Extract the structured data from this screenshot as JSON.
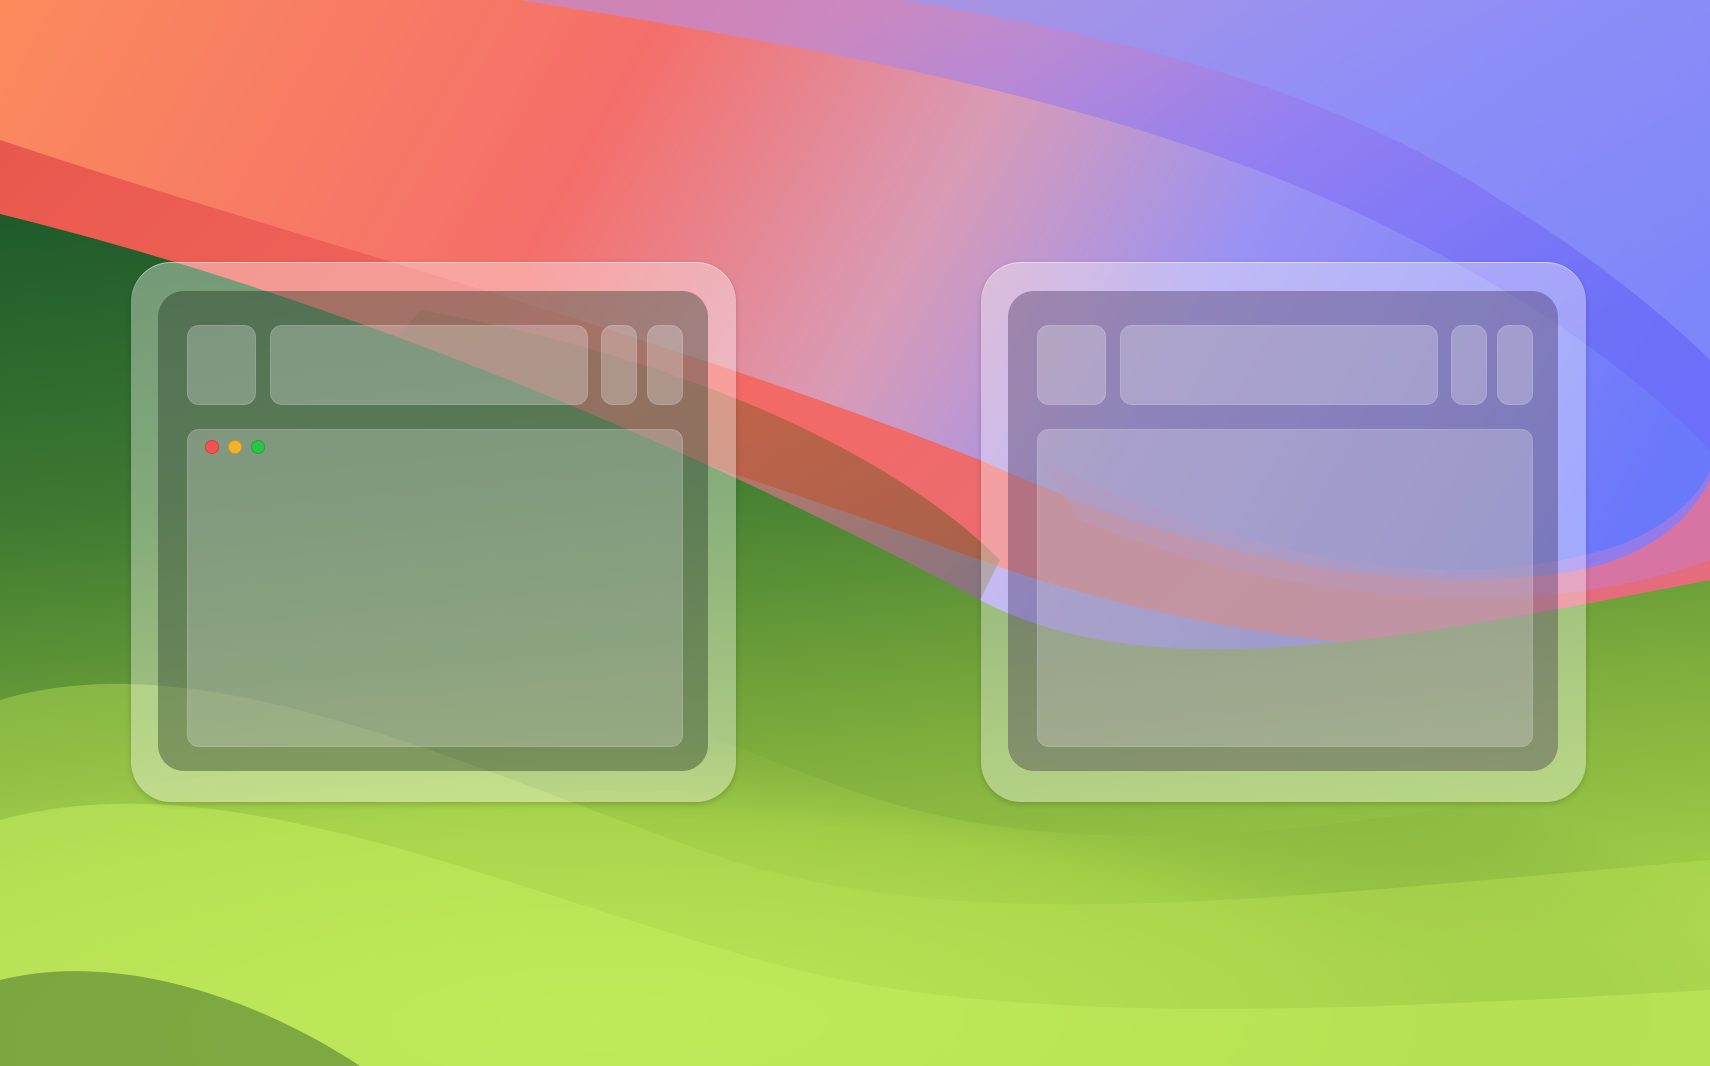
{
  "screen": {
    "description_free": true
  },
  "wallpaper": {
    "colors": {
      "coral": "#f8776a",
      "salmon": "#fb8b5d",
      "pink": "#d99bb6",
      "periwinkle": "#8c8ff8",
      "violet": "#7472f9",
      "dark_green": "#1f5c2c",
      "mid_green": "#4f8a34",
      "lime": "#bde85a"
    }
  },
  "window_left": {
    "traffic_lights": [
      {
        "name": "close",
        "color": "#f2524f"
      },
      {
        "name": "minimize",
        "color": "#f2b32c"
      },
      {
        "name": "zoom",
        "color": "#2bc348"
      }
    ]
  },
  "window_right": {}
}
